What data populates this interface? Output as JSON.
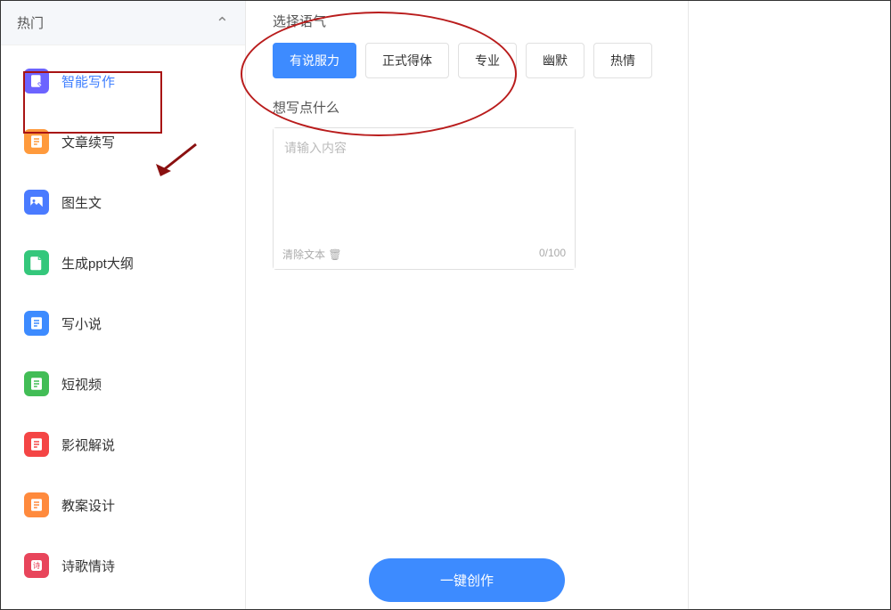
{
  "sidebar": {
    "section_title": "热门",
    "items": [
      {
        "label": "智能写作",
        "selected": true,
        "icon_bg": "bg-purple"
      },
      {
        "label": "文章续写",
        "selected": false,
        "icon_bg": "bg-orange"
      },
      {
        "label": "图生文",
        "selected": false,
        "icon_bg": "bg-blue2"
      },
      {
        "label": "生成ppt大纲",
        "selected": false,
        "icon_bg": "bg-green"
      },
      {
        "label": "写小说",
        "selected": false,
        "icon_bg": "bg-blue"
      },
      {
        "label": "短视频",
        "selected": false,
        "icon_bg": "bg-green2"
      },
      {
        "label": "影视解说",
        "selected": false,
        "icon_bg": "bg-red"
      },
      {
        "label": "教案设计",
        "selected": false,
        "icon_bg": "bg-orange2"
      },
      {
        "label": "诗歌情诗",
        "selected": false,
        "icon_bg": "bg-crimson"
      }
    ]
  },
  "main": {
    "tone_label": "选择语气",
    "tones": [
      {
        "label": "有说服力",
        "active": true
      },
      {
        "label": "正式得体",
        "active": false
      },
      {
        "label": "专业",
        "active": false
      },
      {
        "label": "幽默",
        "active": false
      },
      {
        "label": "热情",
        "active": false
      }
    ],
    "write_label": "想写点什么",
    "placeholder": "请输入内容",
    "clear_label": "清除文本",
    "counter": "0/100",
    "create_button": "一键创作"
  }
}
